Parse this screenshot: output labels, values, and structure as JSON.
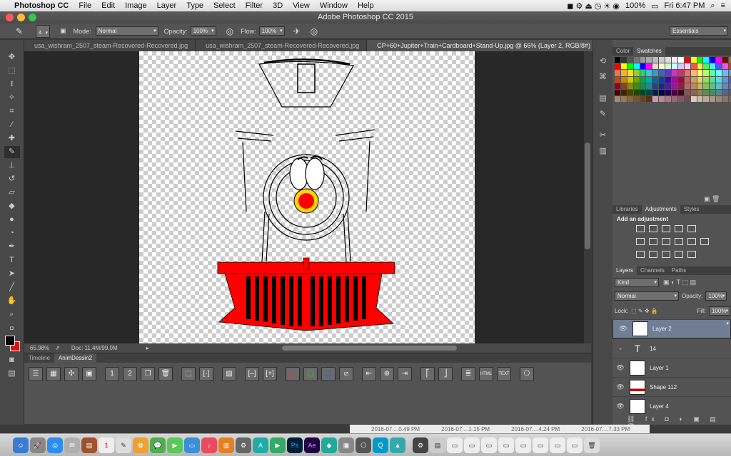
{
  "menubar": {
    "apple": "",
    "app_name": "Photoshop CC",
    "items": [
      "File",
      "Edit",
      "Image",
      "Layer",
      "Type",
      "Select",
      "Filter",
      "3D",
      "View",
      "Window",
      "Help"
    ],
    "battery": "100%",
    "clock": "Fri 6:47 PM"
  },
  "window": {
    "title": "Adobe Photoshop CC 2015"
  },
  "options": {
    "brush_size": "4",
    "mode_label": "Mode:",
    "mode_value": "Normal",
    "opacity_label": "Opacity:",
    "opacity_value": "100%",
    "flow_label": "Flow:",
    "flow_value": "100%",
    "workspace": "Essentials"
  },
  "tabs": [
    {
      "label": "usa_wishram_2507_steam-Recovered-Recovered.jpg"
    },
    {
      "label": "usa_wishram_2507_steam-Recovered-Recovered.jpg"
    },
    {
      "label": "CP+60+Jupiter+Train+Cardboard+Stand-Up.jpg @ 66% (Layer 2, RGB/8#) *"
    }
  ],
  "status": {
    "zoom": "65.98%",
    "doc": "Doc: 11.4M/99.0M"
  },
  "timeline": {
    "tabs": [
      "Timeline",
      "AnimDessin2"
    ]
  },
  "color_panel": {
    "tabs": [
      "Color",
      "Swatches"
    ]
  },
  "adjustments": {
    "tabs": [
      "Libraries",
      "Adjustments",
      "Styles"
    ],
    "hint": "Add an adjustment"
  },
  "layers_panel": {
    "tabs": [
      "Layers",
      "Channels",
      "Paths"
    ],
    "filter": "Kind",
    "blend": "Normal",
    "opacity_label": "Opacity:",
    "opacity_value": "100%",
    "lock_label": "Lock:",
    "fill_label": "Fill:",
    "fill_value": "100%",
    "layers": [
      {
        "name": "Layer 2",
        "selected": true,
        "visible": true
      },
      {
        "name": "14",
        "selected": false,
        "visible": false,
        "type": "text"
      },
      {
        "name": "Layer 1",
        "selected": false,
        "visible": true
      },
      {
        "name": "Shape 112",
        "selected": false,
        "visible": true
      },
      {
        "name": "Layer 4",
        "selected": false,
        "visible": true
      }
    ]
  },
  "behind_window": [
    "2016-07....0.49 PM",
    "2016-07....1.15 PM",
    "2016-07....4.24 PM",
    "2016-07....7.33 PM"
  ],
  "colors": {
    "foreground": "#000000",
    "background": "#e01010",
    "accent": "#ff0000",
    "selected_layer": "#6f7e95"
  }
}
